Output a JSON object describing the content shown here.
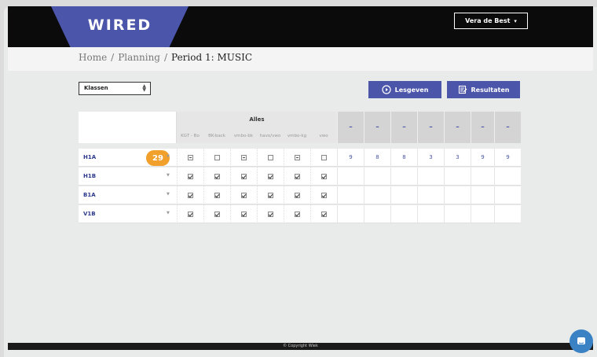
{
  "header": {
    "logo": "WIRED",
    "user": "Vera de Best",
    "caret": "▾"
  },
  "breadcrumb": {
    "home": "Home",
    "planning": "Planning",
    "current": "Period 1: MUSIC",
    "sep": "/"
  },
  "filter": {
    "selected": "Klassen"
  },
  "buttons": {
    "lesgeven": "Lesgeven",
    "resultaten": "Resultaten"
  },
  "table": {
    "alles": "Alles",
    "subcols": [
      "KGT - Bo",
      "BK-back",
      "vmbo-bk",
      "havo/vwo",
      "vmbo-kg",
      "vwo"
    ],
    "dash": "–",
    "rows": [
      {
        "name": "H1A",
        "badge": "29",
        "checks": [
          "part",
          "empty",
          "part",
          "empty",
          "part",
          "empty"
        ],
        "nums": [
          "9",
          "8",
          "8",
          "3",
          "3",
          "9",
          "9"
        ]
      },
      {
        "name": "H1B",
        "checks": [
          "on",
          "on",
          "on",
          "on",
          "on",
          "on"
        ],
        "nums": [
          "",
          "",
          "",
          "",
          "",
          "",
          ""
        ]
      },
      {
        "name": "B1A",
        "checks": [
          "on",
          "on",
          "on",
          "on",
          "on",
          "on"
        ],
        "nums": [
          "",
          "",
          "",
          "",
          "",
          "",
          ""
        ]
      },
      {
        "name": "V1B",
        "checks": [
          "on",
          "on",
          "on",
          "on",
          "on",
          "on"
        ],
        "nums": [
          "",
          "",
          "",
          "",
          "",
          "",
          ""
        ]
      }
    ]
  },
  "footer": {
    "text": "© Copyright Wiek"
  },
  "colors": {
    "brand": "#4b55a9",
    "badge": "#f0a02b",
    "chat": "#3b82c4"
  }
}
